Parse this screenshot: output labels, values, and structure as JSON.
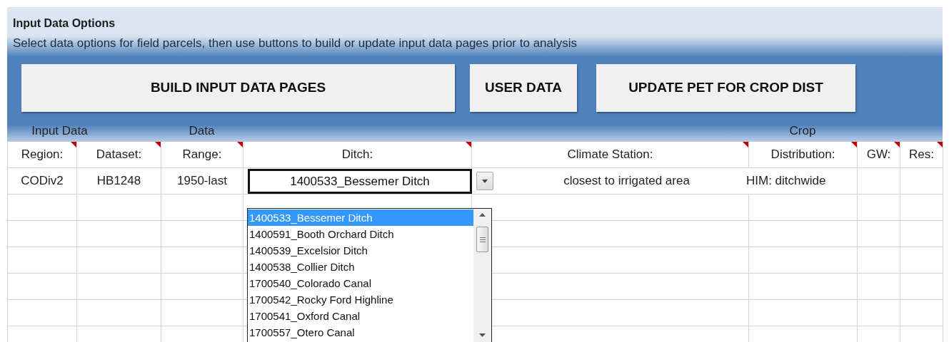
{
  "panel": {
    "title": "Input Data Options",
    "subtitle": "Select data options for field parcels, then use buttons to build or update input data pages prior to analysis"
  },
  "buttons": [
    "BUILD INPUT DATA PAGES",
    "USER DATA",
    "UPDATE PET FOR CROP DIST"
  ],
  "columns": [
    {
      "group": "Input Data",
      "label": "Region:",
      "has_comment": true
    },
    {
      "label": "Dataset:",
      "has_comment": true
    },
    {
      "group": "Data",
      "label": "Range:",
      "has_comment": true
    },
    {
      "label": "Ditch:",
      "has_comment": true
    },
    {
      "label": "Climate Station:",
      "has_comment": true
    },
    {
      "group": "Crop",
      "label": "Distribution:",
      "has_comment": true
    },
    {
      "label": "GW:",
      "has_comment": true
    },
    {
      "label": "Res:",
      "has_comment": true
    }
  ],
  "row": [
    "CODiv2",
    "HB1248",
    "1950-last",
    "1400533_Bessemer Ditch",
    "closest to irrigated area",
    "HIM: ditchwide"
  ],
  "dropdown": {
    "items": [
      {
        "label": "1400533_Bessemer Ditch",
        "selected": true
      },
      {
        "label": "1400591_Booth Orchard Ditch",
        "selected": false
      },
      {
        "label": "1400539_Excelsior Ditch",
        "selected": false
      },
      {
        "label": "1400538_Collier Ditch",
        "selected": false
      },
      {
        "label": "1700540_Colorado Canal",
        "selected": false
      },
      {
        "label": "1700542_Rocky Ford Highline",
        "selected": false
      },
      {
        "label": "1700541_Oxford Canal",
        "selected": false
      },
      {
        "label": "1700557_Otero Canal",
        "selected": false
      }
    ]
  }
}
